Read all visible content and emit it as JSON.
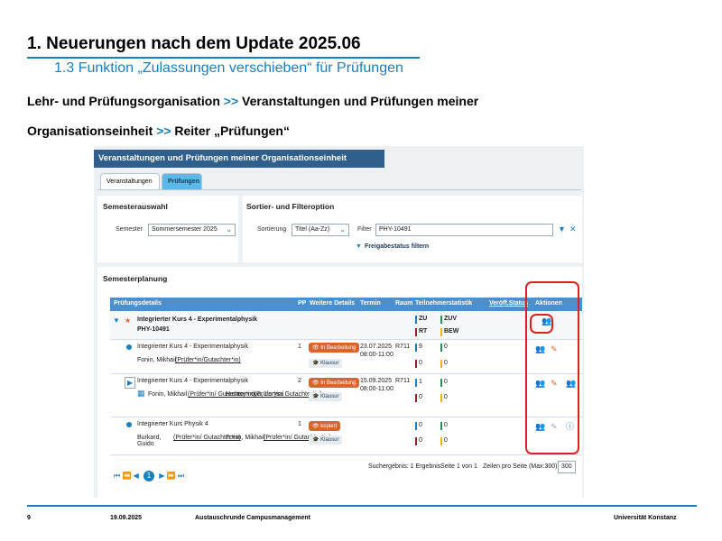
{
  "slide": {
    "title": "1. Neuerungen nach dem Update 2025.06",
    "subtitle": "1.3 Funktion „Zulassungen verschieben“ für Prüfungen",
    "path_line1_a": "Lehr- und Prüfungsorganisation",
    "path_sep": ">>",
    "path_line1_b": "Veranstaltungen und Prüfungen meiner",
    "path_line2_a": "Organisationseinheit",
    "path_line2_b": "Reiter „Prüfungen“"
  },
  "app": {
    "header": "Veranstaltungen und Prüfungen meiner Organisationseinheit",
    "tabs": [
      {
        "label": "Veranstaltungen"
      },
      {
        "label": "Prüfungen"
      }
    ],
    "semesterauswahl": {
      "title": "Semesterauswahl",
      "semester_label": "Semester",
      "semester_value": "Sommersemester 2025"
    },
    "filter": {
      "title": "Sortier- und Filteroption",
      "sort_label": "Sortierung",
      "sort_value": "Titel (Aa-Zz)",
      "filter_label": "Filter",
      "filter_value": "PHY-10491",
      "release_filter": "Freigabestatus filtern"
    },
    "planning_title": "Semesterplanung",
    "columns": [
      "Prüfungsdetails",
      "PP",
      "Weitere Details",
      "Termin",
      "Raum",
      "Teilnehmerstatistik",
      "Veröff.Status",
      "Aktionen"
    ],
    "stat_codes": {
      "zu": "ZU",
      "zuv": "ZUV",
      "rt": "RT",
      "bew": "BEW"
    },
    "rows": [
      {
        "title": "Integrierter Kurs 4 - Experimentalphysik",
        "code": "PHY-10491"
      },
      {
        "title": "Integrierter Kurs 4 - Experimentalphysik",
        "pp": "1",
        "person": "Fonin, Mikhail",
        "role": "(Prüfer*in/Gutachter*in)",
        "status": "In Bearbeitung",
        "kind": "Klausur",
        "date": "23.07.2025",
        "time": "08:00-11:00",
        "room": "R711",
        "s1": "9",
        "s2": "0",
        "s3": "0",
        "s4": "0"
      },
      {
        "title": "Integrierter Kurs 4 - Experimentalphysik",
        "pp": "2",
        "person1": "Fonin, Mikhail",
        "role1": "(Prüfer*in/ Gutachter*in)",
        "person2": "Herasymova, Larysa",
        "role2": "(Prüfer*in/ Gutachter*in)",
        "status": "In Bearbeitung",
        "kind": "Klausur",
        "date": "15.09.2025",
        "time": "08:00-11:00",
        "room": "R711",
        "s1": "1",
        "s2": "0",
        "s3": "0",
        "s4": "0"
      },
      {
        "title": "Integrierter Kurs Physik 4",
        "pp": "1",
        "person1": "Burkard, Guido",
        "role1": "(Prüfer*in/ Gutachter*in)",
        "person2": "Fonin, Mikhail",
        "role2": "(Prüfer*in/ Gutachter*in)",
        "status": "kopiert",
        "kind": "Klausur",
        "s1": "0",
        "s2": "0",
        "s3": "0",
        "s4": "0"
      }
    ],
    "pager": {
      "first": "⏮",
      "prev2": "⏪",
      "prev": "◀",
      "page": "1",
      "next": "▶",
      "next2": "⏩",
      "last": "⏭"
    },
    "search_result": "Suchergebnis: 1 Ergebnis",
    "page_info": "Seite 1 von 1",
    "per_page_label": "Zeilen pro Seite (Max:300)",
    "per_page_value": "300"
  },
  "footer": {
    "page": "9",
    "date": "19.09.2025",
    "event": "Austauschrunde Campusmanagement",
    "org": "Universität Konstanz"
  },
  "colors": {
    "accent": "#1a7fbf",
    "header": "#2f5f8a",
    "highlight": "#e02020",
    "status": "#d9642e"
  }
}
